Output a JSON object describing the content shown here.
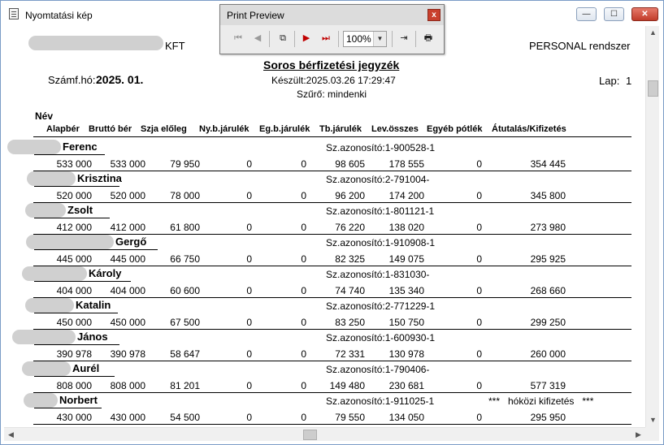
{
  "window": {
    "title": "Nyomtatási kép",
    "min": "—",
    "max": "☐",
    "close": "✕"
  },
  "preview": {
    "title": "Print Preview",
    "close": "x",
    "zoom": "100%",
    "buttons": {
      "first": "⏮",
      "prev": "◀",
      "copy": "⧉",
      "next": "▶",
      "last": "⏭",
      "export": "⇥",
      "print": "🖶"
    }
  },
  "report": {
    "company": "KFT",
    "system": "PERSONAL rendszer",
    "title": "Soros bérfizetési jegyzék",
    "period_label": "Számf.hó:",
    "period": "2025. 01.",
    "created": "Készült:2025.03.26 17:29:47",
    "filter": "Szűrő: mindenki",
    "page_label": "Lap:",
    "page": "1",
    "header_name": "Név",
    "columns": [
      "Alapbér",
      "Bruttó bér",
      "Szja előleg",
      "Ny.b.járulék",
      "Eg.b.járulék",
      "Tb.járulék",
      "Lev.összes",
      "Egyéb pótlék",
      "Átutalás/Kifizetés"
    ]
  },
  "rows": [
    {
      "name": "Ferenc",
      "id": "Sz.azonosító:1-900528-1",
      "values": [
        "533 000",
        "533 000",
        "79 950",
        "0",
        "0",
        "98 605",
        "178 555",
        "0",
        "354 445"
      ],
      "note": ""
    },
    {
      "name": "Krisztina",
      "id": "Sz.azonosító:2-791004-",
      "values": [
        "520 000",
        "520 000",
        "78 000",
        "0",
        "0",
        "96 200",
        "174 200",
        "0",
        "345 800"
      ],
      "note": ""
    },
    {
      "name": "Zsolt",
      "id": "Sz.azonosító:1-801121-1",
      "values": [
        "412 000",
        "412 000",
        "61 800",
        "0",
        "0",
        "76 220",
        "138 020",
        "0",
        "273 980"
      ],
      "note": ""
    },
    {
      "name": "Gergő",
      "id": "Sz.azonosító:1-910908-1",
      "values": [
        "445 000",
        "445 000",
        "66 750",
        "0",
        "0",
        "82 325",
        "149 075",
        "0",
        "295 925"
      ],
      "note": ""
    },
    {
      "name": "Károly",
      "id": "Sz.azonosító:1-831030-",
      "values": [
        "404 000",
        "404 000",
        "60 600",
        "0",
        "0",
        "74 740",
        "135 340",
        "0",
        "268 660"
      ],
      "note": ""
    },
    {
      "name": "Katalin",
      "id": "Sz.azonosító:2-771229-1",
      "values": [
        "450 000",
        "450 000",
        "67 500",
        "0",
        "0",
        "83 250",
        "150 750",
        "0",
        "299 250"
      ],
      "note": ""
    },
    {
      "name": "János",
      "id": "Sz.azonosító:1-600930-1",
      "values": [
        "390 978",
        "390 978",
        "58 647",
        "0",
        "0",
        "72 331",
        "130 978",
        "0",
        "260 000"
      ],
      "note": ""
    },
    {
      "name": "Aurél",
      "id": "Sz.azonosító:1-790406-",
      "values": [
        "808 000",
        "808 000",
        "81 201",
        "0",
        "0",
        "149 480",
        "230 681",
        "0",
        "577 319"
      ],
      "note": ""
    },
    {
      "name": "Norbert",
      "id": "Sz.azonosító:1-911025-1",
      "values": [
        "430 000",
        "430 000",
        "54 500",
        "0",
        "0",
        "79 550",
        "134 050",
        "0",
        "295 950"
      ],
      "note": "***   hóközi kifizetés   ***"
    }
  ],
  "scroll": {
    "up": "▲",
    "down": "▼",
    "left": "◀",
    "right": "▶"
  },
  "colors": {
    "next_arrow": "#c00000",
    "blur": "#d0d0d0"
  }
}
